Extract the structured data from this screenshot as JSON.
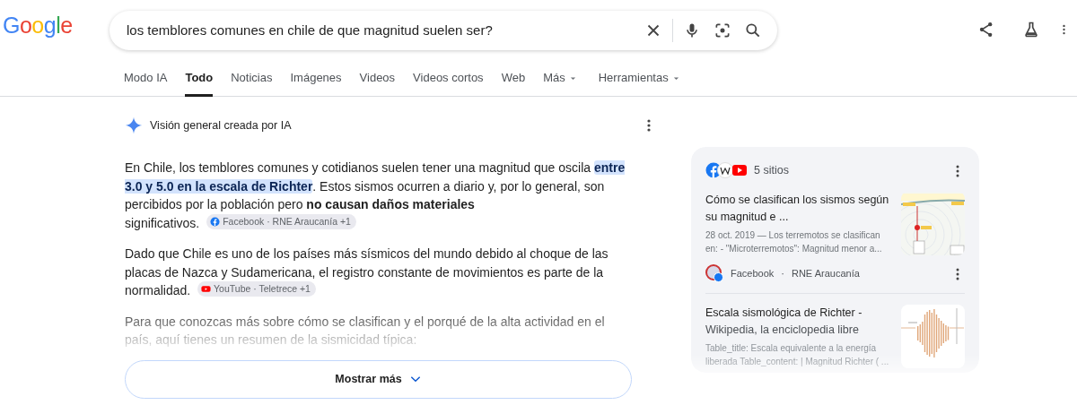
{
  "logo": "Google",
  "search": {
    "value": "los temblores comunes en chile de que magnitud suelen ser?"
  },
  "tabs": [
    {
      "label": "Modo IA",
      "selected": false,
      "dropdown": false
    },
    {
      "label": "Todo",
      "selected": true,
      "dropdown": false
    },
    {
      "label": "Noticias",
      "selected": false,
      "dropdown": false
    },
    {
      "label": "Imágenes",
      "selected": false,
      "dropdown": false
    },
    {
      "label": "Videos",
      "selected": false,
      "dropdown": false
    },
    {
      "label": "Videos cortos",
      "selected": false,
      "dropdown": false
    },
    {
      "label": "Web",
      "selected": false,
      "dropdown": false
    },
    {
      "label": "Más",
      "selected": false,
      "dropdown": true
    },
    {
      "label": "Herramientas",
      "selected": false,
      "dropdown": true
    }
  ],
  "overview": {
    "title": "Visión general creada por IA",
    "paragraphs": [
      {
        "faded": false,
        "segments": [
          {
            "kind": "plain",
            "text": "En Chile, los temblores comunes y cotidianos suelen tener una magnitud que oscila "
          },
          {
            "kind": "highlight",
            "text": "entre 3.0 y 5.0 en la escala de Richter"
          },
          {
            "kind": "plain",
            "text": ". Estos sismos ocurren a diario y, por lo general, son percibidos por la población pero "
          },
          {
            "kind": "bold",
            "text": "no causan daños materiales"
          },
          {
            "kind": "break",
            "text": "significativos."
          }
        ],
        "chip": {
          "text": "Facebook · RNE Araucanía +1"
        }
      },
      {
        "faded": false,
        "segments": [
          {
            "kind": "plain",
            "text": "Dado que Chile es uno de los países más sísmicos del mundo debido al choque de las placas de Nazca y Sudamericana, el registro constante de movimientos es parte de la normalidad."
          }
        ],
        "chip": {
          "text": "YouTube · Teletrece +1"
        }
      },
      {
        "faded": true,
        "segments": [
          {
            "kind": "plain",
            "text": "Para que conozcas más sobre cómo se clasifican y el porqué de la alta actividad en el país, aquí tienes un resumen de la sismicidad típica:"
          }
        ]
      }
    ],
    "show_more": "Mostrar más"
  },
  "sources": {
    "count": "5 sitios",
    "items": [
      {
        "title": "Cómo se clasifican los sismos según su magnitud e ...",
        "snippet": "28 oct. 2019 — Los terremotos se clasifican en: - \"Microterremotos\": Magnitud menor a...",
        "site": "Facebook",
        "separator": "·",
        "author": "RNE Araucanía",
        "faded": false
      },
      {
        "title": "Escala sismológica de Richter -",
        "subtitle": "Wikipedia, la enciclopedia libre",
        "snippet": "Table_title: Escala equivalente a la energía liberada Table_content: | Magnitud Richter ( ...",
        "faded": true
      }
    ]
  }
}
